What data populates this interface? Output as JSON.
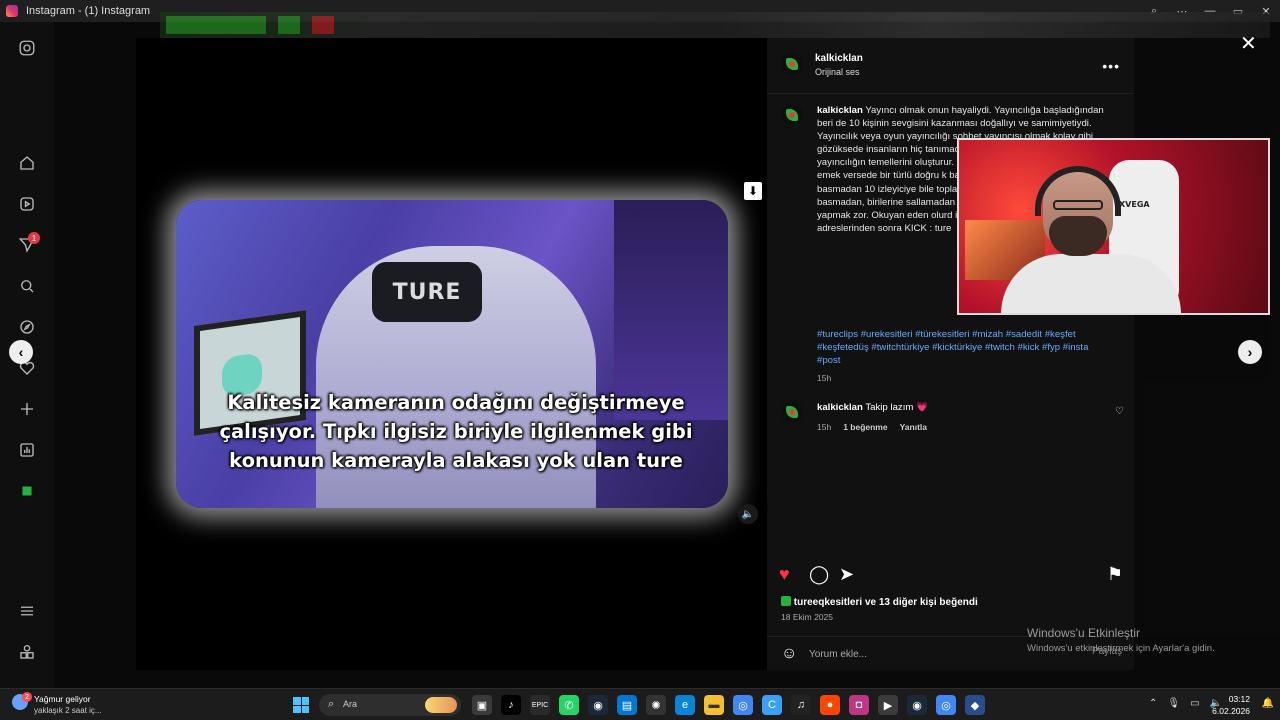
{
  "window": {
    "title": "Instagram - (1) Instagram"
  },
  "post": {
    "author": "kalkicklan",
    "audio": "Orijinal ses",
    "caption": "Yayıncı olmak onun hayaliydi. Yayıncılığa başladığından beri de 10 kişinin sevgisini kazanması doğallıyı ve samimiyetiydi. Yayıncılık veya oyun yayıncılığı sohbet yayıncısı olmak kolay gibi gözüksede insanların hiç tanımadıkları birini sahiplenmeleri ve yayıncılığın temellerini oluşturur. Bu yayınlardan bu yana ileriye giden emek versede bir türlü doğru k basanların yanı sıra onlara karşı bot basmadan 10 izleyiciye bile toplayamadın mı be adam dem basmadan, birilerine sallamadan kendini acındırmadan tiktok kit yapmak zor. Okuyan eden olurd instagram kanallarımızı ture.kic adreslerinden sonra KICK : ture",
    "hashtags": "#tureclips #urekesitleri #türekesitleri #mizah #sadedit #keşfet #keşfetedüş #twitchtürkiye #kicktürkiye #twitch #kick #fyp #insta #post",
    "caption_time": "15h",
    "video_subtitle": "Kalitesiz kameranın odağını değiştirmeye çalışıyor. Tıpkı ilgisiz biriyle ilgilenmek gibi konunun kamerayla alakası yok ulan ture",
    "chair_brand": "TURE",
    "webcam_brand": "XVEGA",
    "comment": {
      "author": "kalkicklan",
      "text": "Takip lazım 💗",
      "time": "15h",
      "likes": "1 beğenme",
      "reply": "Yanıtla"
    },
    "liked_by_user": "tureeqkesitleri",
    "liked_by_rest": "ve 13 diğer kişi beğendi",
    "date": "18 Ekim 2025",
    "comment_placeholder": "Yorum ekle...",
    "share_label": "Paylaş"
  },
  "activation": {
    "title": "Windows'u Etkinleştir",
    "subtitle": "Windows'u etkinleştirmek için Ayarlar'a gidin."
  },
  "taskbar": {
    "weather_title": "Yağmur geliyor",
    "weather_sub": "yaklaşık 2 saat iç...",
    "weather_badge": "2",
    "search_label": "Ara",
    "time": "03:12",
    "date": "6.02.2026"
  },
  "sidebar": {
    "notification_count": "1"
  },
  "colors": {
    "accent_like": "#ff3040",
    "link": "#6aa9ff"
  }
}
